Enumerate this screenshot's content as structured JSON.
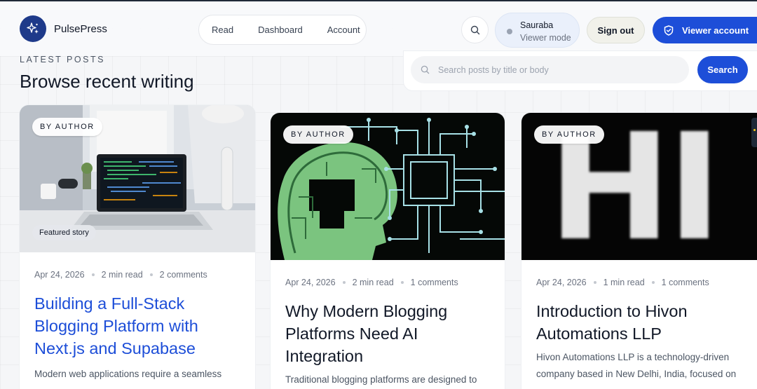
{
  "header": {
    "brand": "PulsePress",
    "nav": [
      "Read",
      "Dashboard",
      "Account"
    ],
    "user": {
      "name": "Sauraba",
      "mode": "Viewer mode"
    },
    "sign_out": "Sign out",
    "viewer_account": "Viewer account"
  },
  "section": {
    "eyebrow": "LATEST POSTS",
    "title": "Browse recent writing"
  },
  "search": {
    "placeholder": "Search posts by title or body",
    "button": "Search"
  },
  "posts": [
    {
      "badge": "BY AUTHOR",
      "featured": "Featured story",
      "date": "Apr 24, 2026",
      "read_time": "2 min read",
      "comments": "2 comments",
      "title": "Building a Full-Stack Blogging Platform with Next.js and Supabase",
      "excerpt": "Modern web applications require a seamless"
    },
    {
      "badge": "BY AUTHOR",
      "date": "Apr 24, 2026",
      "read_time": "2 min read",
      "comments": "1 comments",
      "title": "Why Modern Blogging Platforms Need AI Integration",
      "excerpt": "Traditional blogging platforms are designed to"
    },
    {
      "badge": "BY AUTHOR",
      "date": "Apr 24, 2026",
      "read_time": "1 min read",
      "comments": "1 comments",
      "title": "Introduction to Hivon Automations LLP",
      "excerpt": "Hivon Automations LLP is a technology-driven company based in New Delhi, India, focused on",
      "image_text": "HI"
    }
  ],
  "colors": {
    "accent": "#1d4ed8",
    "brand_logo": "#1e3a8a"
  },
  "icons": [
    "sparkle-icon",
    "search-icon",
    "shield-icon"
  ]
}
